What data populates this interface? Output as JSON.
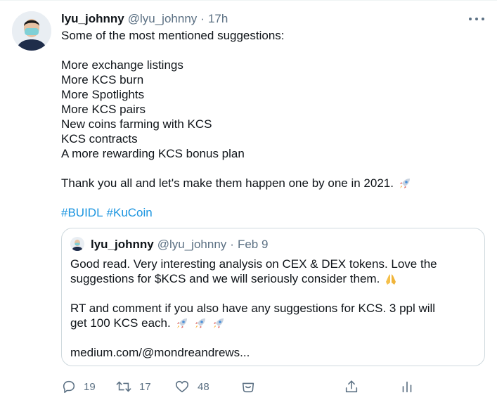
{
  "tweet": {
    "name": "lyu_johnny",
    "handle": "@lyu_johnny",
    "separator": "·",
    "time": "17h",
    "lines": [
      "Some of the most mentioned suggestions:",
      "",
      "More exchange listings",
      "More KCS burn",
      "More Spotlights",
      "More KCS pairs",
      "New coins farming with KCS",
      "KCS contracts",
      "A more rewarding KCS bonus plan",
      "",
      "Thank you all and let's make them happen one by one in 2021."
    ],
    "hashtags": [
      "#BUIDL",
      "#KuCoin"
    ]
  },
  "quote": {
    "name": "lyu_johnny",
    "handle": "@lyu_johnny",
    "separator": "·",
    "time": "Feb 9",
    "lines": [
      "Good read. Very interesting analysis on CEX & DEX tokens. Love the",
      "suggestions for $KCS and we will seriously consider them.",
      "",
      "RT and comment if you also have any suggestions for KCS. 3 ppl will",
      "get 100 KCS each.",
      "",
      "medium.com/@mondreandrews..."
    ]
  },
  "actions": {
    "reply_count": "19",
    "retweet_count": "17",
    "like_count": "48"
  },
  "icons": {
    "rocket": "rocket-emoji",
    "folded_hands": "folded-hands-emoji",
    "more": "more-icon",
    "reply": "reply-icon",
    "retweet": "retweet-icon",
    "like": "heart-icon",
    "tip": "tip-jar-icon",
    "share": "share-icon",
    "analytics": "analytics-icon"
  },
  "colors": {
    "text": "#0f1419",
    "secondary": "#5b7083",
    "link": "#1b95e0",
    "border": "#cfd9de"
  }
}
